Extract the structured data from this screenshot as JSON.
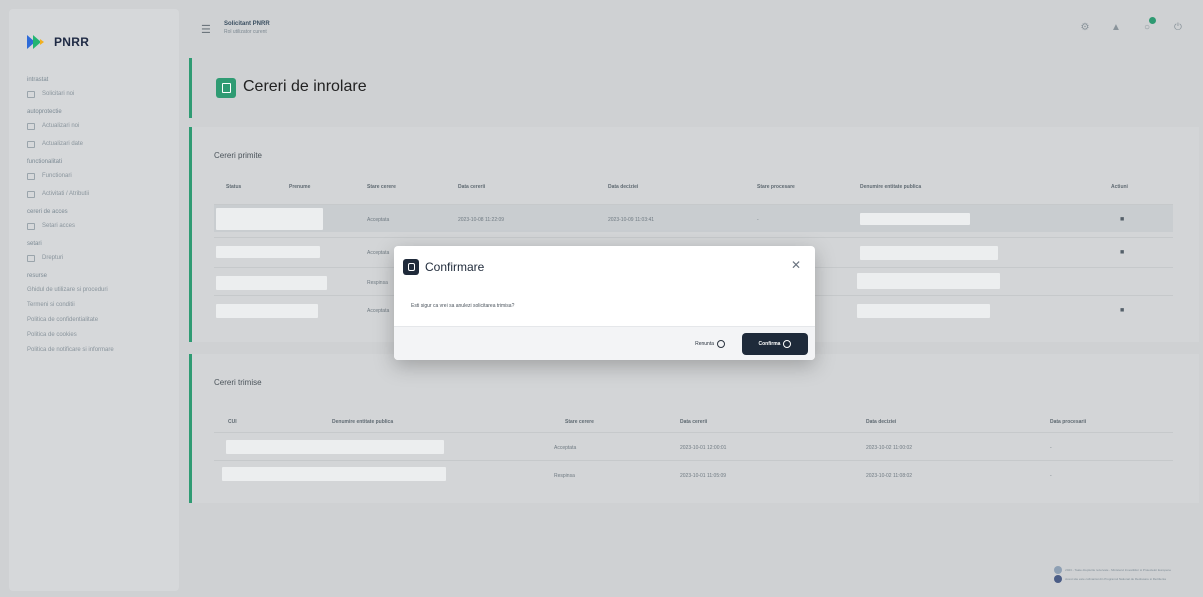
{
  "app": {
    "logo_text": "PNRR"
  },
  "sidebar": {
    "sections": [
      {
        "title": "intrastat",
        "items": [
          {
            "label": "Solicitari noi"
          }
        ]
      },
      {
        "title": "autoprotectie",
        "items": [
          {
            "label": "Actualizari noi"
          },
          {
            "label": "Actualizari date"
          }
        ]
      },
      {
        "title": "functionalitati",
        "items": [
          {
            "label": "Functionari"
          },
          {
            "label": "Activitati / Atributii"
          }
        ]
      },
      {
        "title": "cereri de acces",
        "items": [
          {
            "label": "Setari acces"
          }
        ]
      },
      {
        "title": "setari",
        "items": [
          {
            "label": "Drepturi"
          }
        ]
      }
    ],
    "links_title": "resurse",
    "links": [
      "Ghidul de utilizare si proceduri",
      "Termeni si conditii",
      "Politica de confidentialitate",
      "Politica de cookies",
      "Politica de notificare si informare"
    ]
  },
  "header": {
    "user_name": "Solicitant PNRR",
    "user_role": "Rol utilizator curent"
  },
  "page": {
    "title": "Cereri de inrolare"
  },
  "pending": {
    "title": "Cereri primite",
    "columns": [
      "Status",
      "Prenume",
      "Stare cerere",
      "Data cererii",
      "Data deciziei",
      "Stare procesare",
      "Denumire entitate publica",
      "Actiuni"
    ],
    "rows": [
      {
        "stare": "Acceptata",
        "data_cererii": "2023-10-08 11:22:09",
        "data_deciziei": "2023-10-09 11:03:41",
        "stare_procesare": "-"
      },
      {
        "stare": "Acceptata",
        "data_cererii": "",
        "data_deciziei": "",
        "stare_procesare": ""
      },
      {
        "stare": "Respinsa",
        "data_cererii": "",
        "data_deciziei": "",
        "stare_procesare": ""
      },
      {
        "stare": "Acceptata",
        "data_cererii": "",
        "data_deciziei": "",
        "stare_procesare": ""
      }
    ]
  },
  "history": {
    "title": "Cereri trimise",
    "columns": [
      "CUI",
      "Denumire entitate publica",
      "Stare cerere",
      "Data cererii",
      "Data deciziei",
      "Data procesarii"
    ],
    "rows": [
      {
        "stare": "Acceptata",
        "data_cererii": "2023-10-01 12:00:01",
        "data_deciziei": "2023-10-02 11:00:02",
        "data_procesarii": "-"
      },
      {
        "stare": "Respinsa",
        "data_cererii": "2023-10-01 11:05:09",
        "data_deciziei": "2023-10-02 11:08:02",
        "data_procesarii": "-"
      }
    ]
  },
  "modal": {
    "title": "Confirmare",
    "message": "Esti sigur ca vrei sa anulezi solicitarea trimisa?",
    "cancel_label": "Renunta",
    "confirm_label": "Confirma"
  },
  "footer": {
    "line1": "2023 - Toate drepturile rezervate - Ministerul Investitiilor si Proiectelor Europene",
    "line2": "Acest site este cofinantat din Programul National de Redresare si Rezilienta"
  },
  "colors": {
    "accent": "#2f9b73",
    "primary_dark": "#1e2a3a"
  }
}
